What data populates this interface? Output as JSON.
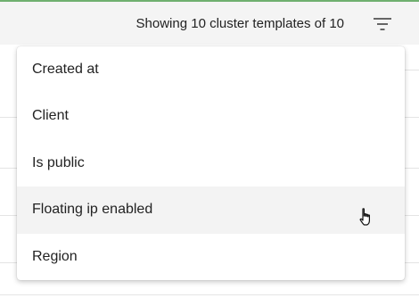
{
  "header": {
    "results_text": "Showing 10 cluster templates of 10",
    "filter_icon": "filter-icon"
  },
  "sort_menu": {
    "items": [
      {
        "label": "Created at",
        "state": "normal"
      },
      {
        "label": "Client",
        "state": "normal"
      },
      {
        "label": "Is public",
        "state": "normal"
      },
      {
        "label": "Floating ip enabled",
        "state": "hovered"
      },
      {
        "label": "Region",
        "state": "normal"
      }
    ]
  },
  "pointer": {
    "icon": "hand-pointer-icon"
  },
  "colors": {
    "accent": "#6fb06f",
    "toolbar_bg": "#f4f4f4",
    "hover_bg": "#f3f3f3",
    "text": "#222222"
  }
}
